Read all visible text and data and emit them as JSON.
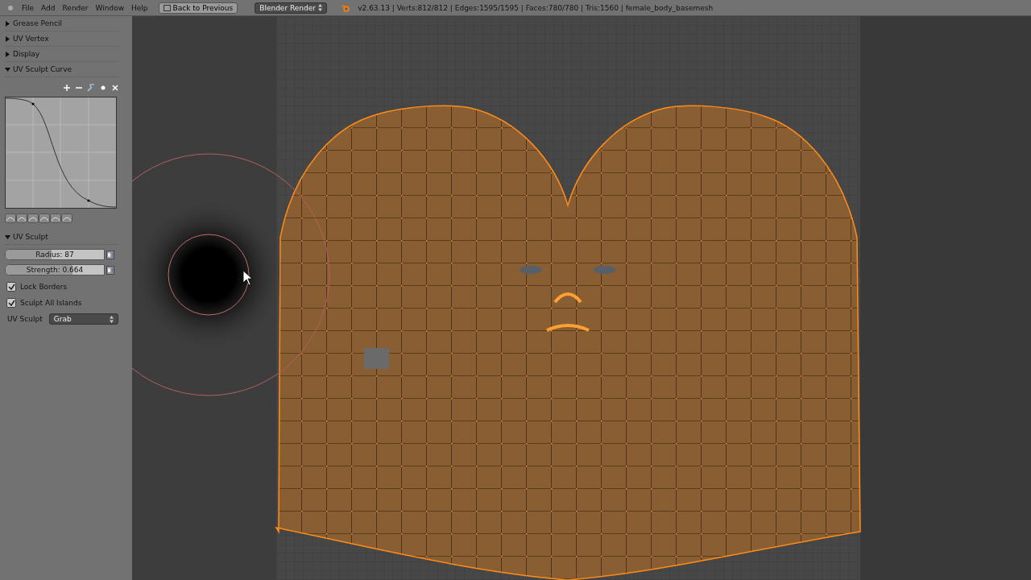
{
  "header": {
    "menus": [
      "File",
      "Add",
      "Render",
      "Window",
      "Help"
    ],
    "back_button": "Back to Previous",
    "render_engine": "Blender Render",
    "stats": "v2.63.13 | Verts:812/812 | Edges:1595/1595 | Faces:780/780 | Tris:1560 | female_body_basemesh"
  },
  "panels": [
    {
      "label": "Grease Pencil",
      "expanded": false
    },
    {
      "label": "UV Vertex",
      "expanded": false
    },
    {
      "label": "Display",
      "expanded": false
    },
    {
      "label": "UV Sculpt Curve",
      "expanded": true
    }
  ],
  "uv_sculpt": {
    "label": "UV Sculpt",
    "expanded": true,
    "sliders": [
      {
        "label": "Radius: 87",
        "level": 0.47
      },
      {
        "label": "Strength: 0.664",
        "level": 0.68
      }
    ],
    "checkboxes": [
      {
        "label": "Lock Borders",
        "checked": true
      },
      {
        "label": "Sculpt All Islands",
        "checked": true
      }
    ],
    "tool": {
      "label": "UV Sculpt",
      "value": "Grab"
    }
  }
}
